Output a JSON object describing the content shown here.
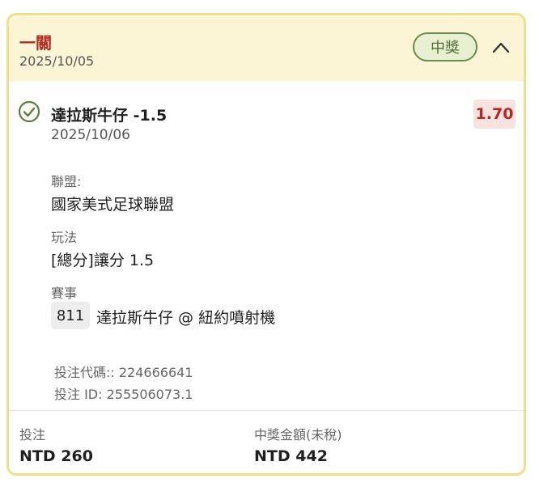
{
  "header": {
    "title": "一關",
    "date": "2025/10/05",
    "status_badge": "中獎"
  },
  "selection": {
    "team_line": "達拉斯牛仔 -1.5",
    "date": "2025/10/06",
    "odds": "1.70",
    "league_label": "聯盟:",
    "league_value": "國家美式足球聯盟",
    "play_label": "玩法",
    "play_value": "[總分]讓分 1.5",
    "event_label": "賽事",
    "event_number": "811",
    "event_name": "達拉斯牛仔 @ 紐約噴射機",
    "bet_code": "投注代碼:: 224666641",
    "bet_id": "投注 ID: 255506073.1"
  },
  "footer": {
    "stake_label": "投注",
    "stake_value": "NTD 260",
    "payout_label": "中獎金額(未稅)",
    "payout_value": "NTD 442"
  },
  "colors": {
    "header_bg": "#fbf5d6",
    "border": "#f0df8a",
    "title_red": "#b22b1e",
    "badge_green": "#6a8b4c"
  }
}
